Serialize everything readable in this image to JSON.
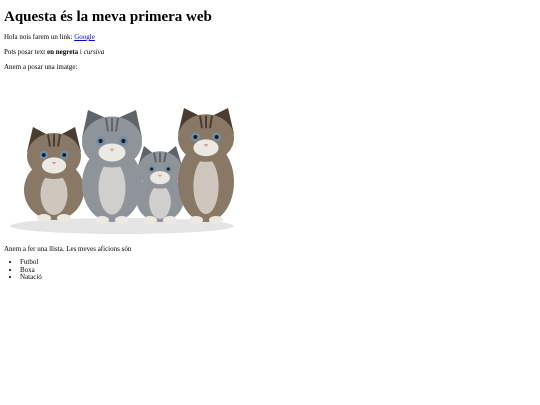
{
  "heading": "Aquesta és la meva primera web",
  "link_paragraph": {
    "text": "Hola nois farem un link: ",
    "link_label": "Google"
  },
  "format_paragraph": {
    "prefix": "Pots posar text ",
    "bold": "en negreta",
    "middle": " i ",
    "italic": "cursiva"
  },
  "image_intro": "Anem a posar una imatge:",
  "image": {
    "subject": "four-kittens-photo",
    "colors": {
      "tabby": "#8a7866",
      "tabby_dark": "#4a3c30",
      "grey": "#8f949a",
      "grey_dark": "#5f646a",
      "light": "#ece8e2",
      "eye": "#6f8fa8",
      "nose": "#d99a9a",
      "shadow": "#e4e4e4"
    }
  },
  "list_intro": "Anem a fer una llista. Les meves aficions són",
  "hobbies": [
    "Futbol",
    "Boxa",
    "Natació"
  ]
}
